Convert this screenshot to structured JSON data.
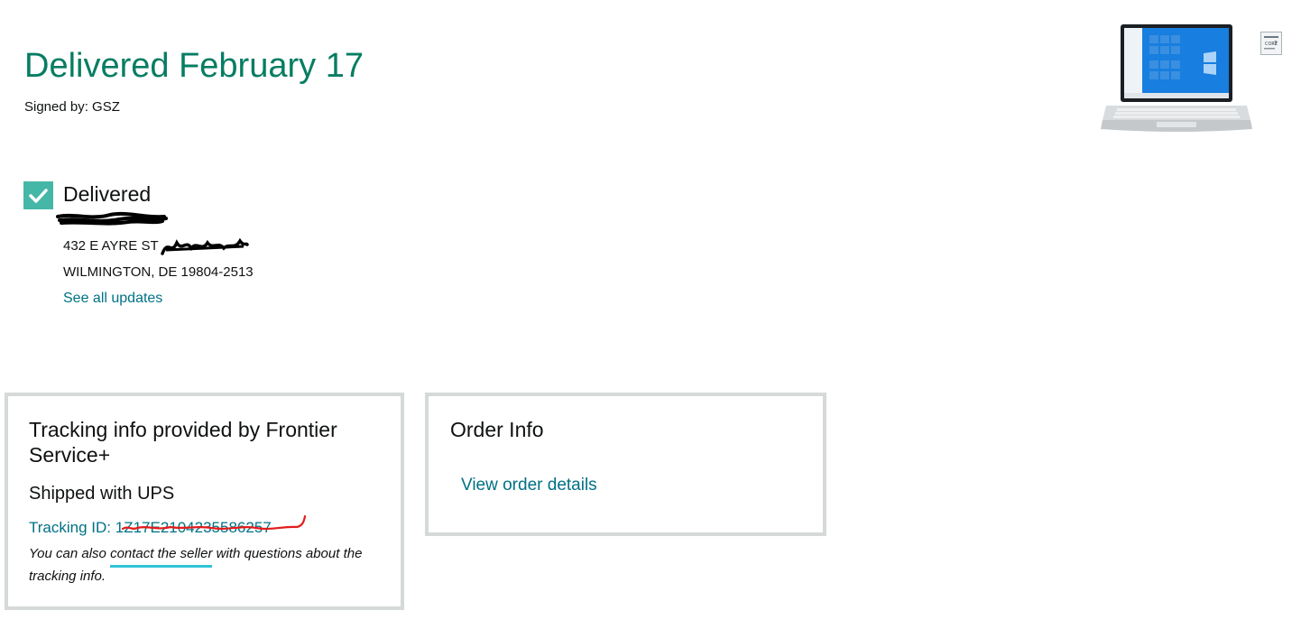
{
  "status": {
    "title": "Delivered February 17",
    "signed_by": "Signed by: GSZ"
  },
  "progress": {
    "step_label": "Delivered",
    "address_line1": "432 E AYRE ST",
    "address_line2": "WILMINGTON, DE 19804-2513",
    "see_all_label": "See all updates"
  },
  "tracking_card": {
    "title": "Tracking info provided by Frontier Service+",
    "shipped_with": "Shipped with UPS",
    "tracking_id_label": "Tracking ID: ",
    "tracking_id": "1Z17E2104235586257",
    "note_prefix": "You can also ",
    "note_link": "contact the seller",
    "note_suffix": " with questions about the tracking info."
  },
  "order_card": {
    "title": "Order Info",
    "view_details_label": "View order details"
  },
  "product": {
    "image_name": "laptop-image",
    "badge_name": "intel-core-i7-badge"
  },
  "colors": {
    "title_green": "#067d62",
    "link_teal": "#007185",
    "check_bg": "#45b7a7",
    "card_border": "#d5d9d9",
    "annotation_red": "#e31b1b",
    "annotation_cyan": "#2ec4d6"
  }
}
